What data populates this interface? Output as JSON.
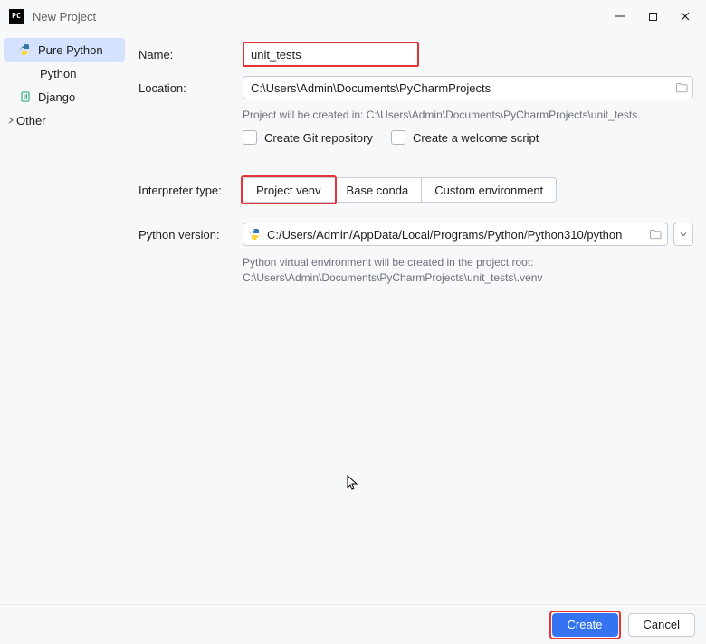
{
  "window": {
    "title": "New Project",
    "app_badge": "PC"
  },
  "sidebar": {
    "items": [
      {
        "label": "Pure Python",
        "type": "python",
        "selected": true
      },
      {
        "label": "Python",
        "type": "child"
      },
      {
        "label": "Django",
        "type": "django"
      },
      {
        "label": "Other",
        "type": "expandable"
      }
    ]
  },
  "form": {
    "name_label": "Name:",
    "name_value": "unit_tests",
    "location_label": "Location:",
    "location_value": "C:\\Users\\Admin\\Documents\\PyCharmProjects",
    "creation_hint": "Project will be created in: C:\\Users\\Admin\\Documents\\PyCharmProjects\\unit_tests",
    "checkbox_git": "Create Git repository",
    "checkbox_welcome": "Create a welcome script",
    "interpreter_label": "Interpreter type:",
    "interpreter_options": {
      "venv": "Project venv",
      "conda": "Base conda",
      "custom": "Custom environment"
    },
    "python_version_label": "Python version:",
    "python_version_value": "C:/Users/Admin/AppData/Local/Programs/Python/Python310/python",
    "venv_note_line1": "Python virtual environment will be created in the project root:",
    "venv_note_line2": "C:\\Users\\Admin\\Documents\\PyCharmProjects\\unit_tests\\.venv"
  },
  "footer": {
    "create": "Create",
    "cancel": "Cancel"
  }
}
